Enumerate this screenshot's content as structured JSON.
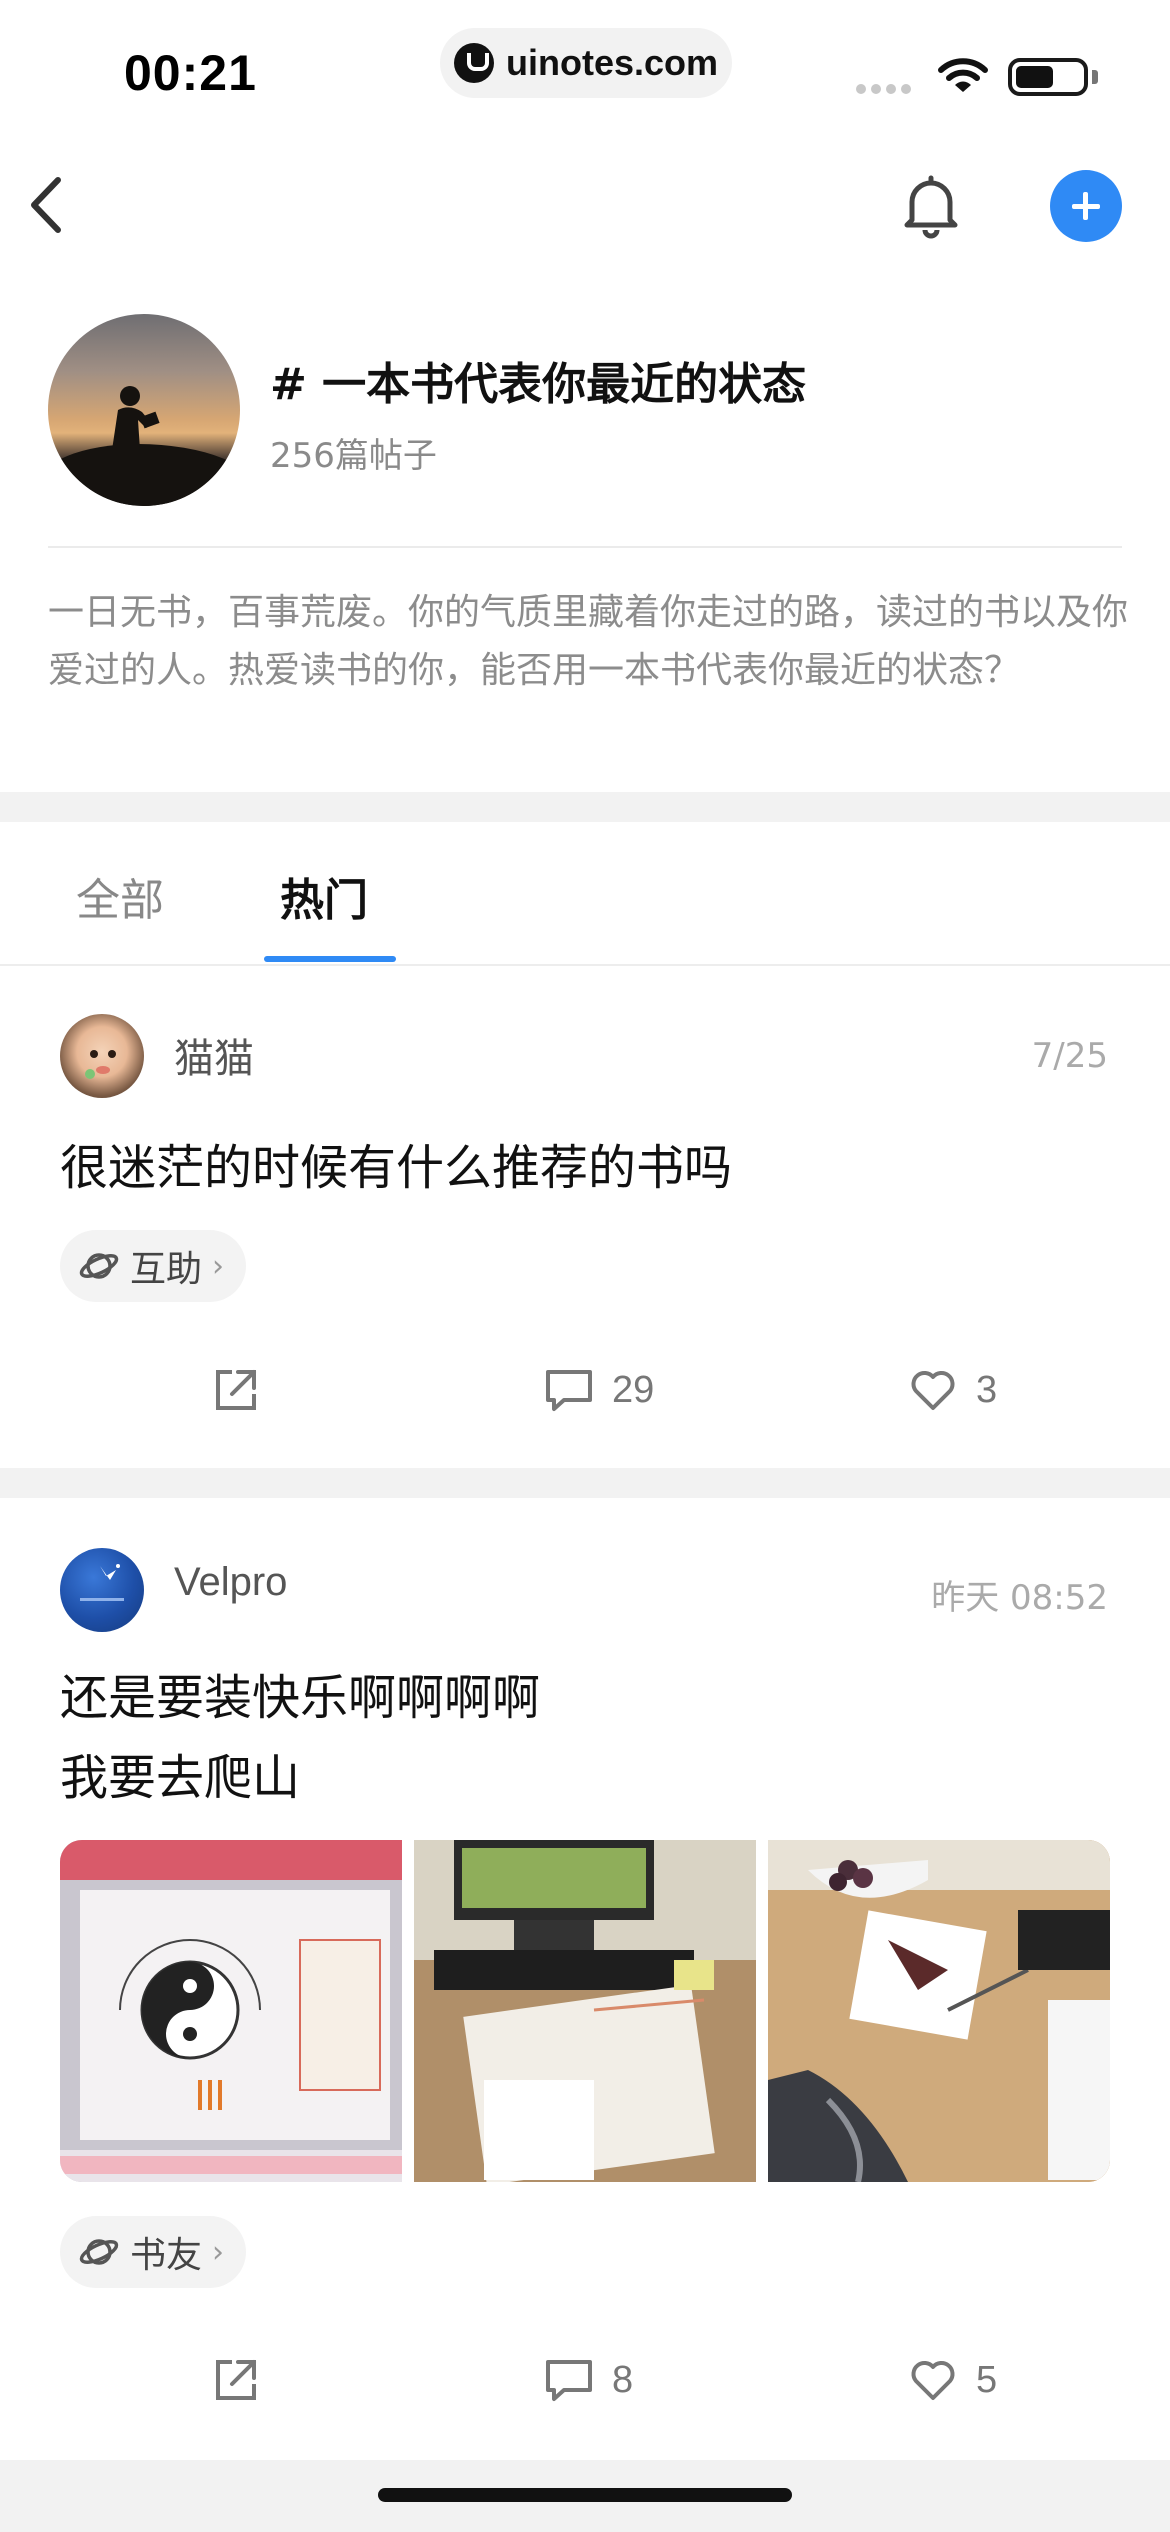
{
  "status_bar": {
    "time": "00:21",
    "url": "uinotes.com"
  },
  "nav": {
    "icons": [
      "back-icon",
      "bell-icon",
      "add-icon"
    ],
    "accent_color": "#2f8af5"
  },
  "topic": {
    "title": "# 一本书代表你最近的状态",
    "post_count": "256篇帖子",
    "description": "一日无书，百事荒废。你的气质里藏着你走过的路，读过的书以及你爱过的人。热爱读书的你，能否用一本书代表你最近的状态？"
  },
  "tabs": [
    {
      "label": "全部",
      "active": false
    },
    {
      "label": "热门",
      "active": true
    }
  ],
  "posts": [
    {
      "user": "猫猫",
      "date": "7/25",
      "text": "很迷茫的时候有什么推荐的书吗",
      "tag": "互助",
      "comments": "29",
      "likes": "3"
    },
    {
      "user": "Velpro",
      "date": "昨天 08:52",
      "text_lines": [
        "还是要装快乐啊啊啊啊",
        "我要去爬山"
      ],
      "images": [
        "feng-shui-poster-photo",
        "desk-monitor-book-photo",
        "desk-snack-photo"
      ],
      "tag": "书友",
      "comments": "8",
      "likes": "5"
    }
  ]
}
